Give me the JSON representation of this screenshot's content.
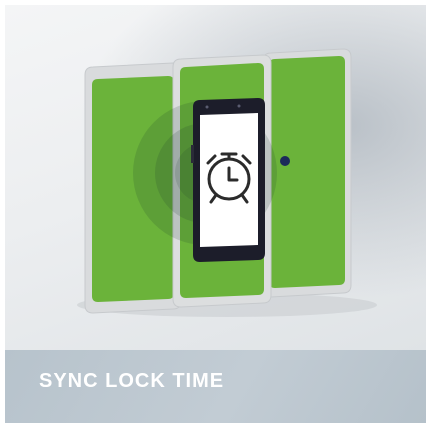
{
  "banner": {
    "title": "SYNC LOCK TIME"
  },
  "colors": {
    "panel_green": "#6bb33a",
    "frame_grey": "#d6d8da",
    "banner_bg": "#bcc7cf",
    "phone_body": "#1c1d2a"
  },
  "icons": {
    "phone_screen_icon": "alarm-clock-icon"
  }
}
